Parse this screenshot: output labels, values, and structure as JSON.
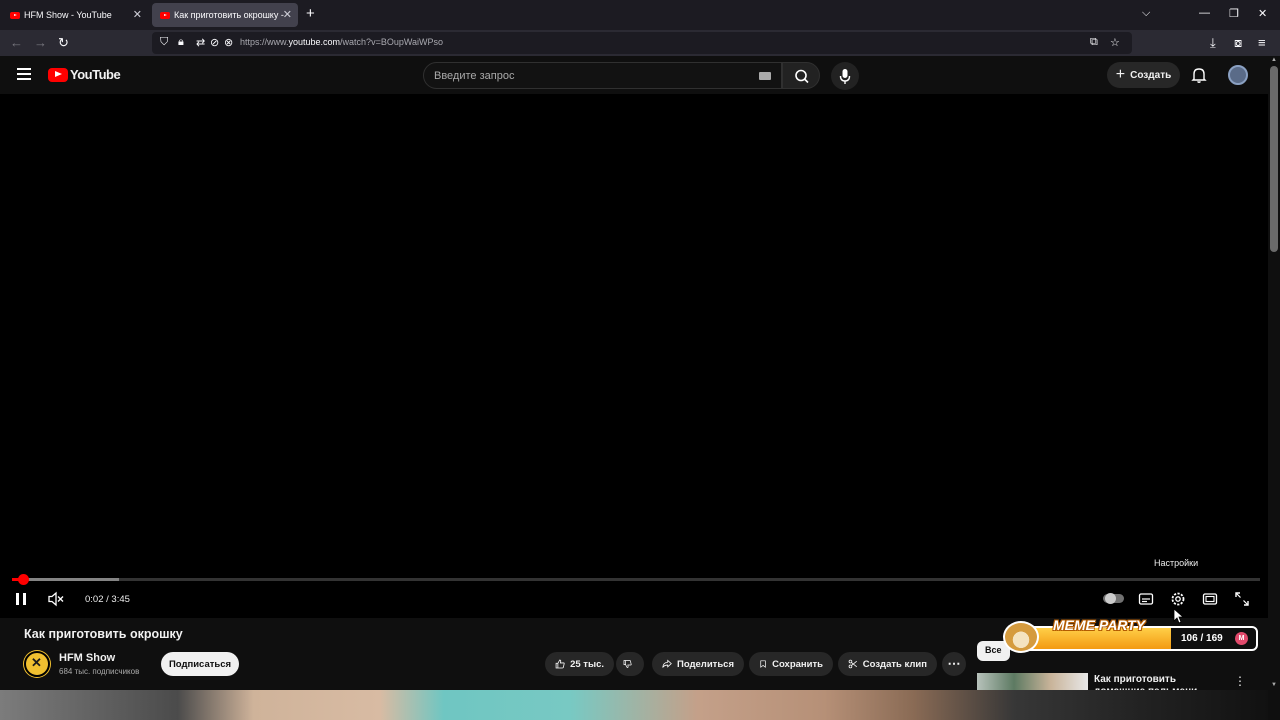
{
  "browser": {
    "tabs": [
      {
        "title": "HFM Show - YouTube",
        "active": false
      },
      {
        "title": "Как приготовить окрошку - YouTube",
        "active": true
      }
    ],
    "url_prefix": "https://www.",
    "url_domain": "youtube.com",
    "url_path": "/watch?v=BOupWaiWPso"
  },
  "header": {
    "logo_text": "YouTube",
    "search_placeholder": "Введите запрос",
    "create_label": "Создать"
  },
  "player": {
    "time_display": "0:02 / 3:45",
    "progress_fraction": 0.009,
    "buffered_fraction": 0.086,
    "tooltip": "Настройки",
    "muted": true,
    "playing": true
  },
  "video": {
    "title": "Как приготовить окрошку",
    "channel_name": "HFM Show",
    "channel_subs": "684 тыс. подписчиков",
    "subscribe_label": "Подписаться",
    "like_count": "25 тыс.",
    "share_label": "Поделиться",
    "save_label": "Сохранить",
    "clip_label": "Создать клип"
  },
  "sidebar": {
    "chip_label": "Все",
    "recommendation_title": "Как приготовить домашние пельмени"
  },
  "overlay": {
    "label": "MEME PARTY",
    "count": "106 / 169",
    "progress_fraction": 0.63,
    "badge": "M"
  },
  "colors": {
    "accent": "#ff0000",
    "background": "#0f0f0f",
    "meme_fill": "#f39a12"
  }
}
